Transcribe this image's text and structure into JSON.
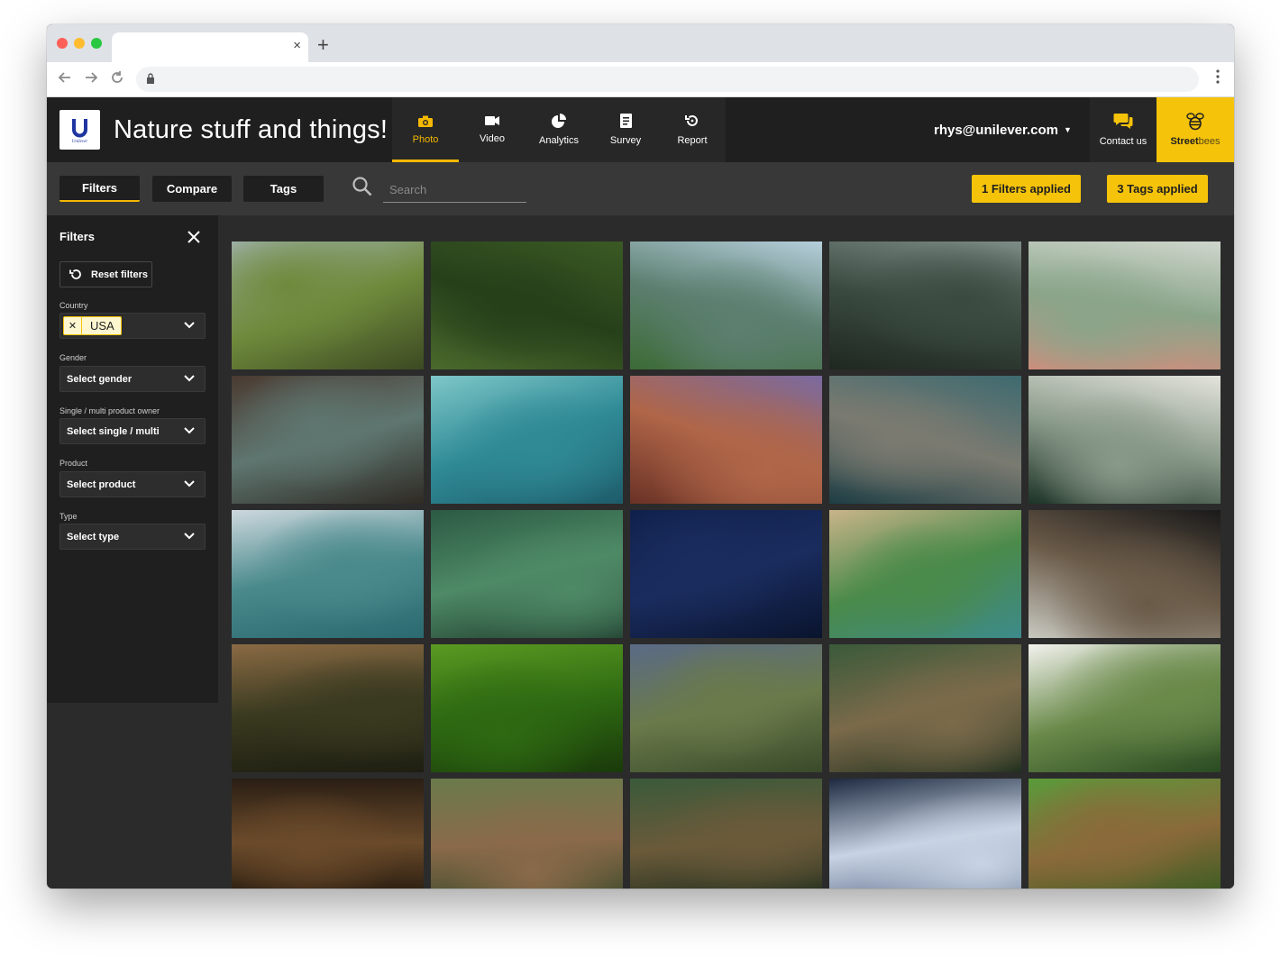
{
  "browser": {
    "new_tab_glyph": "+",
    "close_glyph": "×"
  },
  "app": {
    "title": "Nature stuff and things!",
    "accent_color": "#f5c30a"
  },
  "nav": {
    "photo": "Photo",
    "video": "Video",
    "analytics": "Analytics",
    "survey": "Survey",
    "report": "Report"
  },
  "user": {
    "email": "rhys@unilever.com"
  },
  "contact": {
    "label": "Contact us"
  },
  "brand": {
    "part1": "Street",
    "part2": "bees"
  },
  "toolbar": {
    "filters": "Filters",
    "compare": "Compare",
    "tags": "Tags",
    "search_placeholder": "Search",
    "filters_applied": "1 Filters applied",
    "tags_applied": "3 Tags applied"
  },
  "sidebar": {
    "title": "Filters",
    "reset": "Reset filters",
    "country_label": "Country",
    "country_value": "USA",
    "gender_label": "Gender",
    "gender_value": "Select gender",
    "owner_label": "Single / multi product owner",
    "owner_value": "Select single / multi",
    "product_label": "Product",
    "product_value": "Select product",
    "type_label": "Type",
    "type_value": "Select type"
  },
  "gallery": {
    "photos": [
      {
        "name": "photo-green-hills-valley",
        "colors": [
          "#a8b9c0",
          "#6f8a3c",
          "#3c4a22"
        ]
      },
      {
        "name": "photo-aerial-forest-road",
        "colors": [
          "#3b5a24",
          "#26401a",
          "#4a6a2c"
        ]
      },
      {
        "name": "photo-lake-mountains",
        "colors": [
          "#b6cfdc",
          "#5c7f70",
          "#3d6b36"
        ]
      },
      {
        "name": "photo-jungle-cliff",
        "colors": [
          "#7d8c86",
          "#3a4a40",
          "#1f2820"
        ]
      },
      {
        "name": "photo-white-flowers",
        "colors": [
          "#cfd6cc",
          "#8aa58a",
          "#d98a7a"
        ]
      },
      {
        "name": "photo-fern-leaf",
        "colors": [
          "#4a3a30",
          "#5f7670",
          "#2f2a24"
        ]
      },
      {
        "name": "photo-turquoise-river",
        "colors": [
          "#7ec7c8",
          "#2f8a96",
          "#1e5c6a"
        ]
      },
      {
        "name": "photo-grand-canyon",
        "colors": [
          "#7a6aa0",
          "#b06648",
          "#6a3226"
        ]
      },
      {
        "name": "photo-elephant-water",
        "colors": [
          "#3e6a70",
          "#7a7a70",
          "#1e3e44"
        ]
      },
      {
        "name": "photo-misty-forest",
        "colors": [
          "#e4e4dc",
          "#8a9a8a",
          "#1e3428"
        ]
      },
      {
        "name": "photo-mountain-lake-reflection",
        "colors": [
          "#cdd8de",
          "#4a8a8c",
          "#2a6a70"
        ]
      },
      {
        "name": "photo-green-leaves",
        "colors": [
          "#2c5a44",
          "#4e8a66",
          "#1e3a2c"
        ]
      },
      {
        "name": "photo-night-sunset",
        "colors": [
          "#0f1f4a",
          "#1a2c5e",
          "#0a142e"
        ]
      },
      {
        "name": "photo-aerial-lake-road",
        "colors": [
          "#c9b48a",
          "#4a8a4a",
          "#3d8a8a"
        ]
      },
      {
        "name": "photo-window-curtain",
        "colors": [
          "#1a1a1a",
          "#6a5a48",
          "#c8c8c0"
        ]
      },
      {
        "name": "photo-meadow-sunset",
        "colors": [
          "#8a6a44",
          "#3a3a20",
          "#1e1e12"
        ]
      },
      {
        "name": "photo-green-plant-leaves",
        "colors": [
          "#5a9a22",
          "#2e6a12",
          "#1a3a0a"
        ]
      },
      {
        "name": "photo-mountain-valley",
        "colors": [
          "#5a6a86",
          "#6a7a4a",
          "#3a4a2a"
        ]
      },
      {
        "name": "photo-woman-bridge",
        "colors": [
          "#3a5a3a",
          "#7a6a4a",
          "#1e2e1e"
        ]
      },
      {
        "name": "photo-wheat-field",
        "colors": [
          "#f2f2ee",
          "#6a8a4a",
          "#2a4a22"
        ]
      },
      {
        "name": "photo-dark-forest-path",
        "colors": [
          "#2a1e14",
          "#6a4a2a",
          "#1a120a"
        ]
      },
      {
        "name": "photo-forest-trail",
        "colors": [
          "#6a7a4a",
          "#8a6a4a",
          "#3a4a2a"
        ]
      },
      {
        "name": "photo-woman-walkway",
        "colors": [
          "#3a5a3a",
          "#6a5a3a",
          "#1a2a1a"
        ]
      },
      {
        "name": "photo-glass-building",
        "colors": [
          "#1e2a40",
          "#c8d4e4",
          "#4a5a7a"
        ]
      },
      {
        "name": "photo-eagle",
        "colors": [
          "#5a9a3a",
          "#8a6a3a",
          "#2e5a1e"
        ]
      }
    ]
  }
}
